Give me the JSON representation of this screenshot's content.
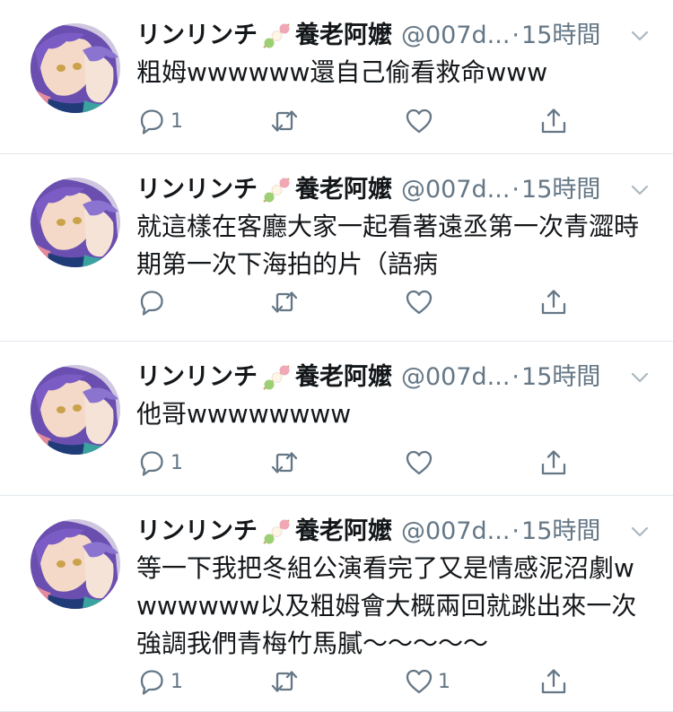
{
  "colors": {
    "text": "#14171a",
    "secondary": "#657786",
    "divider": "#e1e8ed"
  },
  "tweets": [
    {
      "name": "リンリンチ",
      "name_suffix": "養老阿嬤",
      "handle": "@007d...",
      "separator": "·",
      "time": "15時間",
      "text": "粗姆wwwwww還自己偷看救命www",
      "reply_count": "1",
      "retweet_count": "",
      "like_count": ""
    },
    {
      "name": "リンリンチ",
      "name_suffix": "養老阿嬤",
      "handle": "@007d...",
      "separator": "·",
      "time": "15時間",
      "text": "就這樣在客廳大家一起看著遠丞第一次青澀時期第一次下海拍的片（語病",
      "reply_count": "",
      "retweet_count": "",
      "like_count": ""
    },
    {
      "name": "リンリンチ",
      "name_suffix": "養老阿嬤",
      "handle": "@007d...",
      "separator": "·",
      "time": "15時間",
      "text": "他哥wwwwwwww",
      "reply_count": "1",
      "retweet_count": "",
      "like_count": ""
    },
    {
      "name": "リンリンチ",
      "name_suffix": "養老阿嬤",
      "handle": "@007d...",
      "separator": "·",
      "time": "15時間",
      "text": "等一下我把冬組公演看完了又是情感泥沼劇wwwwwww以及粗姆會大概兩回就跳出來一次強調我們青梅竹馬膩〜〜〜〜〜",
      "reply_count": "1",
      "retweet_count": "",
      "like_count": "1"
    }
  ]
}
